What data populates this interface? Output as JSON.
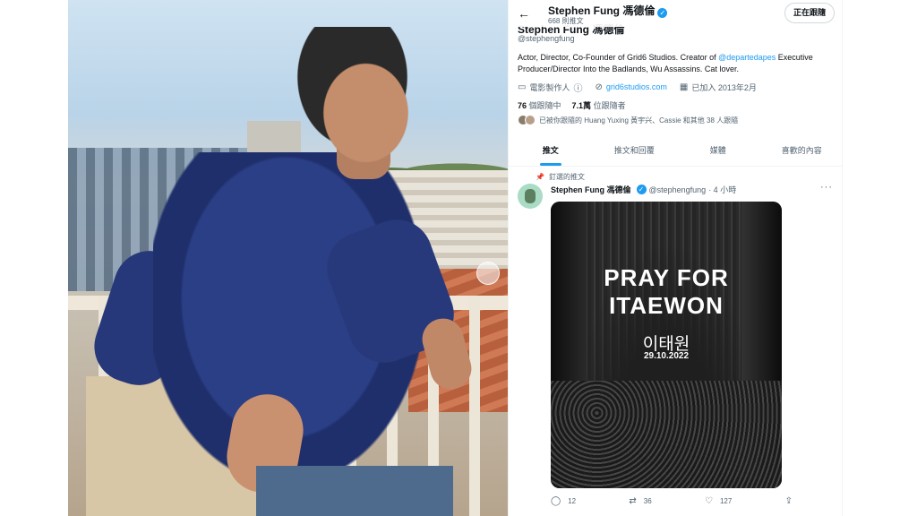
{
  "photo": {
    "alt": "profile photo carousel"
  },
  "profile": {
    "name": "Stephen Fung 馮德倫",
    "tweet_count": "668 則推文",
    "handle": "@stephengfung",
    "follow_button": "正在跟隨",
    "bio_pre": "Actor, Director, Co-Founder of Grid6 Studios. Creator of ",
    "bio_link": "@departedapes",
    "bio_post": " Executive Producer/Director Into the Badlands, Wu Assassins. Cat lover.",
    "category": "電影製作人",
    "website": "grid6studios.com",
    "joined": "已加入 2013年2月",
    "following_count": "76",
    "following_label": "個跟隨中",
    "followers_count": "7.1萬",
    "followers_label": "位跟隨者",
    "followed_by": "已被你跟隨的 Huang Yuxing 黃宇兴、Cassie 和其他 38 人跟隨"
  },
  "tabs": [
    "推文",
    "推文和回覆",
    "媒體",
    "喜歡的內容"
  ],
  "tweet": {
    "pinned_label": "釘選的推文",
    "name": "Stephen Fung 馮德倫",
    "handle": "@stephengfung",
    "time": "· 4 小時",
    "image_title_line1": "PRAY FOR",
    "image_title_line2": "ITAEWON",
    "image_korean": "이태원",
    "image_date": "29.10.2022",
    "replies": "12",
    "retweets": "36",
    "likes": "127"
  },
  "icons": {
    "back": "arrow-left-icon",
    "verified": "verified-badge-icon",
    "category": "briefcase-icon",
    "info": "info-icon",
    "link": "link-icon",
    "calendar": "calendar-icon",
    "pin": "pin-icon",
    "more": "more-icon",
    "reply": "reply-icon",
    "retweet": "retweet-icon",
    "like": "heart-icon",
    "share": "share-icon"
  },
  "colors": {
    "accent": "#1d9bf0",
    "text": "#0f1419",
    "muted": "#536471"
  }
}
